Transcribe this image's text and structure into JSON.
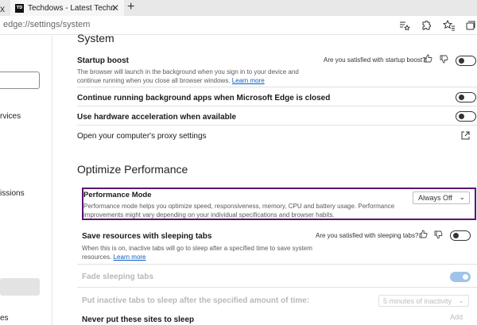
{
  "browser": {
    "left_tab_close": "x",
    "tab": {
      "favicon": "TD",
      "title": "Techdows - Latest Technology N",
      "close": "✕"
    },
    "new_tab": "+",
    "url": "edge://settings/system",
    "toolbar_icons": [
      "read-aloud-favorite-icon",
      "extensions-icon",
      "favorites-star-icon",
      "collections-icon"
    ]
  },
  "sidebar": {
    "items": [
      {
        "label": "rvices"
      },
      {
        "label": "issions"
      },
      {
        "label": "es"
      }
    ]
  },
  "system": {
    "heading": "System",
    "startup_boost": {
      "title": "Startup boost",
      "desc": "The browser will launch in the background when you sign in to your device and continue running when you close all browser windows.",
      "link": "Learn more",
      "question": "Are you satisfied with startup boost?",
      "enabled": false
    },
    "background_apps": {
      "title": "Continue running background apps when Microsoft Edge is closed",
      "enabled": false
    },
    "hardware_accel": {
      "title": "Use hardware acceleration when available",
      "enabled": false
    },
    "proxy": {
      "title": "Open your computer's proxy settings"
    }
  },
  "optimize": {
    "heading": "Optimize Performance",
    "performance_mode": {
      "title": "Performance Mode",
      "desc": "Performance mode helps you optimize speed, responsiveness, memory, CPU and battery usage. Performance improvements might vary depending on your individual specifications and browser habits.",
      "selected": "Always Off"
    },
    "sleeping_tabs": {
      "title": "Save resources with sleeping tabs",
      "desc": "When this is on, inactive tabs will go to sleep after a specified time to save system resources.",
      "link": "Learn more",
      "question": "Are you satisfied with sleeping tabs?",
      "enabled": false
    },
    "fade_sleeping": {
      "title": "Fade sleeping tabs",
      "enabled": true
    },
    "inactive_after": {
      "title": "Put inactive tabs to sleep after the specified amount of time:",
      "selected": "5 minutes of inactivity"
    },
    "never_sleep": {
      "title": "Never put these sites to sleep",
      "button": "Add"
    }
  }
}
